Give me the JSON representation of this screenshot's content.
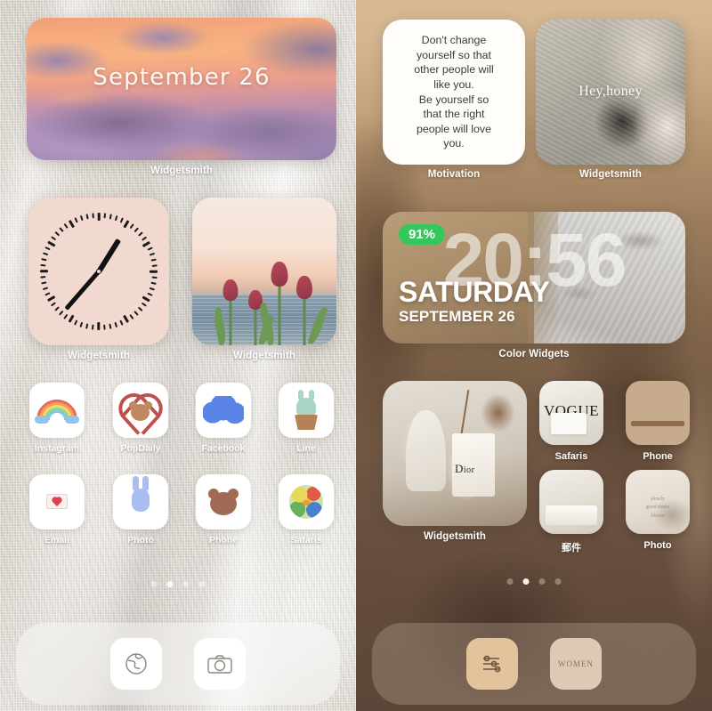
{
  "left_screen": {
    "widgets": [
      {
        "id": "sunset-date",
        "date_text": "September 26",
        "label": "Widgetsmith"
      },
      {
        "id": "clock",
        "label": "Widgetsmith"
      },
      {
        "id": "tulips",
        "label": "Widgetsmith"
      }
    ],
    "apps_row1": [
      {
        "name": "Instagram",
        "icon": "rainbow-icon"
      },
      {
        "name": "PopDaily",
        "icon": "bear-heart-icon"
      },
      {
        "name": "Facebook",
        "icon": "blue-cloud-icon"
      },
      {
        "name": "Line",
        "icon": "cactus-bunny-icon"
      }
    ],
    "apps_row2": [
      {
        "name": "Email",
        "icon": "envelope-heart-icon"
      },
      {
        "name": "Photo",
        "icon": "blue-bunny-icon"
      },
      {
        "name": "Phone",
        "icon": "brown-bear-icon"
      },
      {
        "name": "Safaris",
        "icon": "colorful-ball-icon"
      }
    ],
    "page_dots": {
      "count": 4,
      "active_index": 1
    },
    "dock": [
      {
        "name": "Safari",
        "icon": "globe-icon"
      },
      {
        "name": "Camera",
        "icon": "camera-icon"
      }
    ]
  },
  "right_screen": {
    "widgets": [
      {
        "id": "motivation-quote",
        "quote": "Don't change\nyourself so that\nother people will\nlike you.\nBe yourself so\nthat the right\npeople will love\nyou.",
        "label": "Motivation"
      },
      {
        "id": "hey-honey-photo",
        "overlay_text": "Hey,honey",
        "label": "Widgetsmith"
      },
      {
        "id": "color-widgets-clock",
        "battery": "91%",
        "time": "20:56",
        "weekday": "SATURDAY",
        "date": "SEPTEMBER 26",
        "label": "Color Widgets"
      },
      {
        "id": "dior-photo",
        "label": "Widgetsmith"
      }
    ],
    "apps": [
      {
        "name": "Safaris",
        "icon": "vogue-magazine-icon"
      },
      {
        "name": "Phone",
        "icon": "shelf-shadow-icon"
      },
      {
        "name": "郵件",
        "icon": "folded-shirt-icon"
      },
      {
        "name": "Photo",
        "icon": "plant-shadow-icon"
      }
    ],
    "page_dots": {
      "count": 4,
      "active_index": 1
    },
    "dock": [
      {
        "name": "Settings",
        "icon": "sliders-icon"
      },
      {
        "name": "Women",
        "icon": "women-text-icon",
        "text": "WOMEN"
      }
    ]
  },
  "colors": {
    "battery_green": "#34c759",
    "clock_widget_bg": "#f2d9cf",
    "quote_card_bg": "#fffdfa"
  }
}
